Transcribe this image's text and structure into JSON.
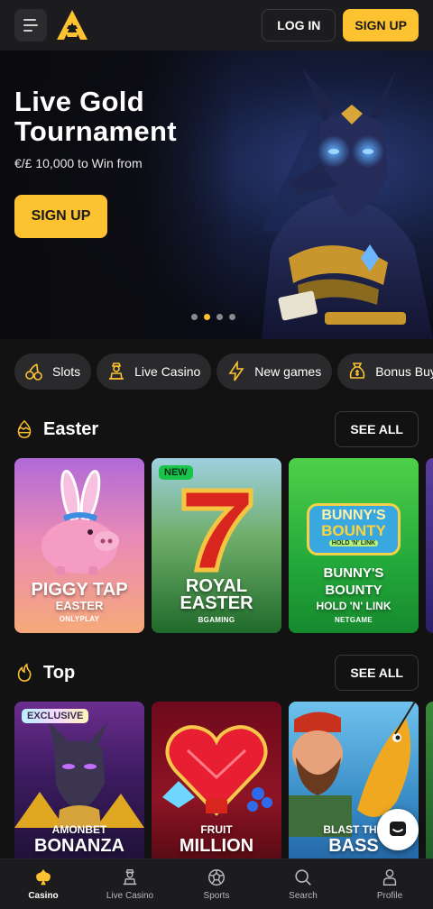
{
  "header": {
    "login_label": "LOG IN",
    "signup_label": "SIGN UP",
    "menu_icon": "hamburger-menu-icon",
    "logo_icon": "amonbet-logo"
  },
  "hero": {
    "title": "Live Gold Tournament",
    "subtitle": "€/£ 10,000 to Win from",
    "cta_label": "SIGN UP",
    "slide_count": 4,
    "active_slide": 2
  },
  "categories": [
    {
      "label": "Slots",
      "icon": "cherries-icon"
    },
    {
      "label": "Live Casino",
      "icon": "dealer-icon"
    },
    {
      "label": "New games",
      "icon": "lightning-icon"
    },
    {
      "label": "Bonus Buy",
      "icon": "coin-bag-icon"
    }
  ],
  "sections": [
    {
      "title": "Easter",
      "icon": "easter-egg-icon",
      "see_all_label": "SEE ALL",
      "games": [
        {
          "title_line1": "PIGGY TAP",
          "title_line2": "EASTER",
          "provider": "ONLYPLAY",
          "badge": ""
        },
        {
          "title_line1": "ROYAL",
          "title_line2": "EASTER",
          "provider": "BGAMING",
          "badge": "NEW"
        },
        {
          "title_line1": "BUNNY'S",
          "title_line2": "BOUNTY",
          "title_line3": "HOLD 'N' LINK",
          "provider": "NETGAME",
          "badge": ""
        }
      ]
    },
    {
      "title": "Top",
      "icon": "flame-icon",
      "see_all_label": "SEE ALL",
      "games": [
        {
          "title_line1": "AMONBET",
          "title_line2": "BONANZA",
          "badge": "EXCLUSIVE"
        },
        {
          "title_line1": "FRUIT",
          "title_line2": "MILLION",
          "badge": ""
        },
        {
          "title_line1": "BLAST THE",
          "title_line2": "BASS",
          "badge": ""
        }
      ]
    }
  ],
  "art_text": {
    "bunny_logo_line1": "BUNNY'S",
    "bunny_logo_line2": "BOUNTY",
    "bunny_logo_line3": "HOLD 'N' LINK"
  },
  "bottom_nav": [
    {
      "label": "Casino",
      "icon": "casino-icon",
      "active": true
    },
    {
      "label": "Live Casino",
      "icon": "dealer-icon",
      "active": false
    },
    {
      "label": "Sports",
      "icon": "soccer-ball-icon",
      "active": false
    },
    {
      "label": "Search",
      "icon": "search-icon",
      "active": false
    },
    {
      "label": "Profile",
      "icon": "user-icon",
      "active": false
    }
  ],
  "colors": {
    "accent": "#fdc22f",
    "background": "#121212",
    "surface": "#1c1c1e",
    "new_badge": "#19c44b"
  }
}
